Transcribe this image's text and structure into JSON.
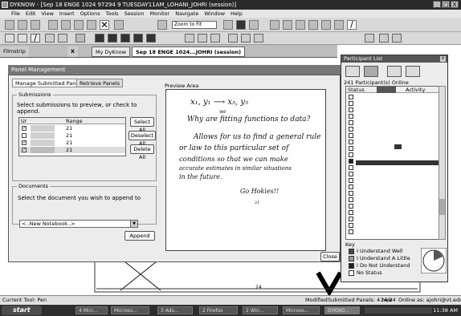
{
  "window": {
    "title": "DYKNOW - [Sep 18 ENGE 1024 97294 9 TUESDAY11AM_LOHANI_JOHRI (session)]",
    "controls": [
      "_",
      "□",
      "X"
    ]
  },
  "menu": [
    "File",
    "Edit",
    "View",
    "Insert",
    "Options",
    "Tools",
    "Session",
    "Monitor",
    "Navigate",
    "Window",
    "Help"
  ],
  "toolbar": {
    "zoom": "Zoom to Fit"
  },
  "tabs": {
    "filmstrip": "Filmstrip",
    "close": "X",
    "tab1": "My DyKnow",
    "tab2": "Sep 18 ENGE 1024...JOHRI (session)"
  },
  "panel": {
    "title": "Panel Management",
    "tabs": [
      "Manage Submitted Panels",
      "Retrieve Panels"
    ],
    "submissions": {
      "label": "Submissions",
      "instruction": "Select submissions to preview, or check to append.",
      "columns": [
        "Ur",
        "Range"
      ],
      "rows": [
        {
          "checked": true,
          "range": "21"
        },
        {
          "checked": false,
          "range": "21"
        },
        {
          "checked": true,
          "range": "21"
        },
        {
          "checked": true,
          "range": "21"
        }
      ],
      "buttons": [
        "Select All",
        "Deselect All",
        "Delete All"
      ]
    },
    "documents": {
      "label": "Documents",
      "instruction": "Select the document you wish to append to",
      "selected": "<..New Notebook..>"
    },
    "append": "Append",
    "preview_label": "Preview Area",
    "close": "Close",
    "handwriting": [
      "x₁, y₁   ⟶   x₅, y₅",
      "Why are fitting functions to data?",
      "Allows for us to find a general rule",
      "or law to this particular set of",
      "conditions so that we can make",
      "accurate estimates in similar situations",
      "in the future.",
      "Go Hokies!!"
    ],
    "handwriting_extras": {
      "we": "we",
      "page": "21"
    }
  },
  "participants": {
    "title": "Participant List",
    "count": "241 Participant(s) Online",
    "columns": [
      "Status",
      "",
      "Activity"
    ],
    "key_label": "Key",
    "key": [
      {
        "label": "I Understand Well",
        "color": "#4a4a4a"
      },
      {
        "label": "I Understand A Little",
        "color": "#9a9a9a"
      },
      {
        "label": "I Do Not Understand",
        "color": "#222222"
      },
      {
        "label": "No Status",
        "color": "#ffffff"
      }
    ]
  },
  "status": {
    "tool": "Current Tool: Pen",
    "modified": "Modified",
    "submitted": "Submitted Panels: 4 new",
    "pages": "24/24",
    "online": "Online as: ajohri@vt.edu"
  },
  "taskbar": {
    "start": "start",
    "tasks": [
      "4 Micr...",
      "Microso...",
      "3 Ado...",
      "2 Firefox",
      "2 Win...",
      "Microso...",
      "DYKNO..."
    ],
    "clock": "11:38 AM"
  },
  "doc": {
    "page_number": "24"
  }
}
